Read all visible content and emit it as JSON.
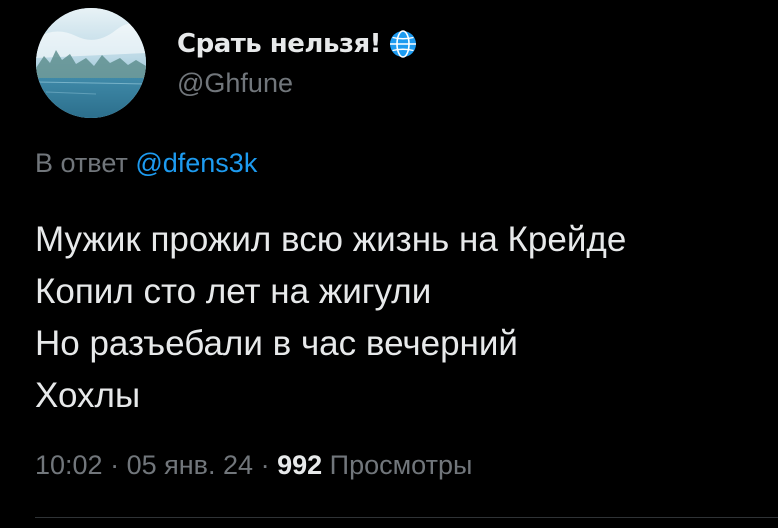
{
  "author": {
    "display_name": "Срать нельзя!",
    "handle": "@Ghfune",
    "badge_icon": "globe-icon",
    "badge_color": "#1d9bf0"
  },
  "reply": {
    "prefix": "В ответ",
    "to_handle": "@dfens3k"
  },
  "tweet": {
    "lines": [
      "Мужик прожил всю жизнь на Крейде",
      "Копил сто лет на жигули",
      "Но разъебали в час вечерний",
      "Хохлы"
    ]
  },
  "meta": {
    "time": "10:02",
    "sep1": "·",
    "date": "05 янв. 24",
    "sep2": "·",
    "views_count": "992",
    "views_label": "Просмотры"
  },
  "colors": {
    "background": "#000000",
    "text": "#e7e9ea",
    "secondary": "#71767b",
    "link": "#1d9bf0"
  }
}
